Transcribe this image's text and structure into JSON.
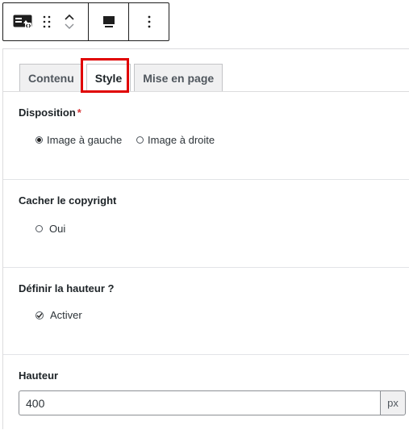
{
  "toolbar": {
    "block_icon": "image-block-icon",
    "drag_icon": "drag-handle-icon",
    "move_up_icon": "chevron-up-icon",
    "move_down_icon": "chevron-down-icon",
    "align_icon": "align-top-icon",
    "more_icon": "more-vertical-icon"
  },
  "tabs": [
    {
      "label": "Contenu",
      "active": false
    },
    {
      "label": "Style",
      "active": true
    },
    {
      "label": "Mise en page",
      "active": false
    }
  ],
  "highlight_color": "#e00000",
  "disposition": {
    "label": "Disposition",
    "required_mark": "*",
    "options": [
      {
        "label": "Image à gauche",
        "selected": true
      },
      {
        "label": "Image à droite",
        "selected": false
      }
    ]
  },
  "copyright": {
    "label": "Cacher le copyright",
    "option": "Oui",
    "selected": false
  },
  "hauteur_toggle": {
    "label": "Définir la hauteur ?",
    "option": "Activer",
    "checked": true
  },
  "hauteur": {
    "label": "Hauteur",
    "value": "400",
    "unit": "px"
  }
}
